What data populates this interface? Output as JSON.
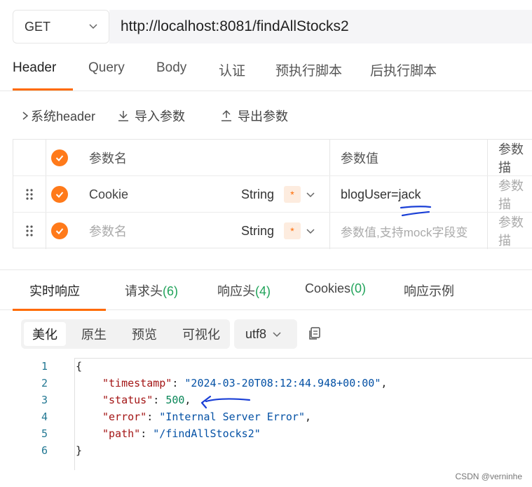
{
  "request": {
    "method": "GET",
    "url": "http://localhost:8081/findAllStocks2"
  },
  "request_tabs": [
    "Header",
    "Query",
    "Body",
    "认证",
    "预执行脚本",
    "后执行脚本"
  ],
  "toolbar": {
    "system_header": "系统header",
    "import": "导入参数",
    "export": "导出参数"
  },
  "param_table": {
    "headers": {
      "name": "参数名",
      "value": "参数值",
      "desc": "参数描"
    },
    "rows": [
      {
        "name": "Cookie",
        "type": "String",
        "required": "*",
        "value": "blogUser=jack",
        "desc": "参数描"
      },
      {
        "name": "参数名",
        "type": "String",
        "required": "*",
        "value": "参数值,支持mock字段变",
        "desc": "参数描"
      }
    ]
  },
  "response_tabs": [
    {
      "label": "实时响应",
      "count": ""
    },
    {
      "label": "请求头",
      "count": "(6)"
    },
    {
      "label": "响应头",
      "count": "(4)"
    },
    {
      "label": "Cookies",
      "count": "(0)"
    },
    {
      "label": "响应示例",
      "count": ""
    }
  ],
  "view_modes": [
    "美化",
    "原生",
    "预览",
    "可视化"
  ],
  "encoding": "utf8",
  "code": {
    "line_numbers": [
      "1",
      "2",
      "3",
      "4",
      "5",
      "6"
    ],
    "open_brace": "{",
    "close_brace": "}",
    "entries": [
      {
        "key": "\"timestamp\"",
        "value": "\"2024-03-20T08:12:44.948+00:00\"",
        "trail": ","
      },
      {
        "key": "\"status\"",
        "value": "500",
        "trail": ","
      },
      {
        "key": "\"error\"",
        "value": "\"Internal Server Error\"",
        "trail": ","
      },
      {
        "key": "\"path\"",
        "value": "\"/findAllStocks2\"",
        "trail": ""
      }
    ]
  },
  "watermark": "CSDN @verninhe",
  "colors": {
    "accent": "#ff6a00",
    "count": "#21a35a",
    "annotation": "#1a3fd6"
  }
}
